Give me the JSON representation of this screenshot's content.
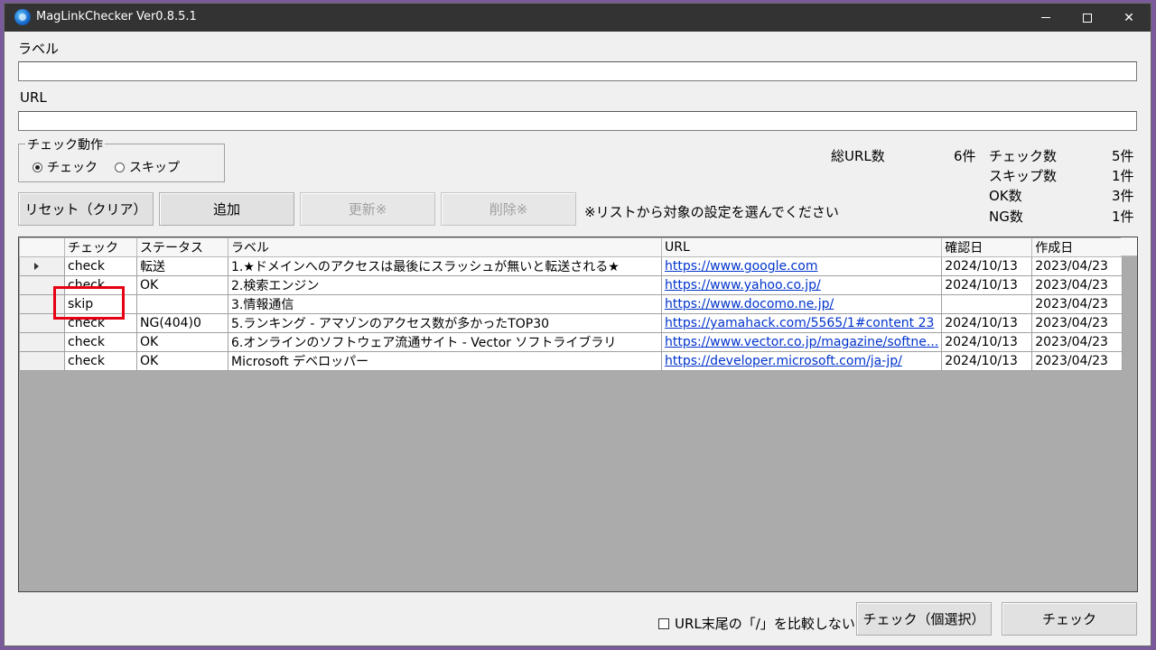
{
  "window": {
    "title": "MagLinkChecker Ver0.8.5.1"
  },
  "form": {
    "label_caption": "ラベル",
    "label_value": "",
    "url_caption": "URL",
    "url_value": ""
  },
  "check_action": {
    "title": "チェック動作",
    "options": [
      {
        "label": "チェック",
        "selected": true
      },
      {
        "label": "スキップ",
        "selected": false
      }
    ]
  },
  "stats": {
    "total_url_label": "総URL数",
    "total_url_value": "6件",
    "check_label": "チェック数",
    "check_value": "5件",
    "skip_label": "スキップ数",
    "skip_value": "1件",
    "ok_label": "OK数",
    "ok_value": "3件",
    "ng_label": "NG数",
    "ng_value": "1件"
  },
  "buttons": {
    "reset": "リセット（クリア）",
    "add": "追加",
    "update": "更新※",
    "delete": "削除※",
    "hint": "※リストから対象の設定を選んでください",
    "check_selected": "チェック（個選択）",
    "check": "チェック"
  },
  "options": {
    "ignore_trailing_slash": "URL末尾の「/」を比較しない",
    "ignore_trailing_slash_checked": false
  },
  "table": {
    "columns": [
      "チェック",
      "ステータス",
      "ラベル",
      "URL",
      "確認日",
      "作成日"
    ],
    "rows": [
      {
        "current": true,
        "check": "check",
        "status": "転送",
        "label": "1.★ドメインへのアクセスは最後にスラッシュが無いと転送される★",
        "url": "https://www.google.com",
        "confirmed": "2024/10/13",
        "created": "2023/04/23"
      },
      {
        "current": false,
        "check": "check",
        "status": "OK",
        "label": "2.検索エンジン",
        "url": "https://www.yahoo.co.jp/",
        "confirmed": "2024/10/13",
        "created": "2023/04/23"
      },
      {
        "current": false,
        "check": "skip",
        "status": "",
        "label": "3.情報通信",
        "url": "https://www.docomo.ne.jp/",
        "confirmed": "",
        "created": "2023/04/23"
      },
      {
        "current": false,
        "check": "check",
        "status": "NG(404)0",
        "label": "5.ランキング - アマゾンのアクセス数が多かったTOP30",
        "url": "https://yamahack.com/5565/1#content 23",
        "confirmed": "2024/10/13",
        "created": "2023/04/23"
      },
      {
        "current": false,
        "check": "check",
        "status": "OK",
        "label": "6.オンラインのソフトウェア流通サイト - Vector ソフトライブラリ",
        "url": "https://www.vector.co.jp/magazine/softne...",
        "confirmed": "2024/10/13",
        "created": "2023/04/23"
      },
      {
        "current": false,
        "check": "check",
        "status": "OK",
        "label": "Microsoft デベロッパー",
        "url": "https://developer.microsoft.com/ja-jp/",
        "confirmed": "2024/10/13",
        "created": "2023/04/23"
      }
    ]
  },
  "colors": {
    "titlebar": "#333333",
    "link": "#0033cc",
    "highlight": "#e60012",
    "grid_background": "#ababab"
  }
}
